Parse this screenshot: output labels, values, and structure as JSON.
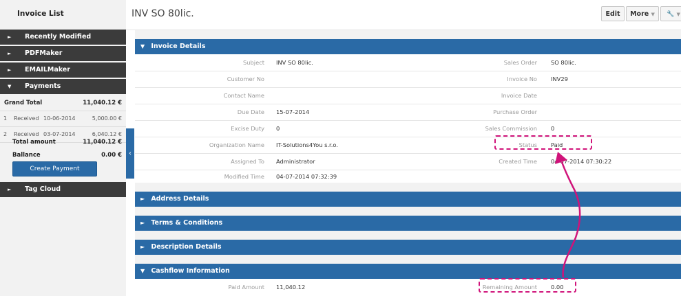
{
  "sidebar": {
    "title": "Invoice List",
    "sections": {
      "recently_modified": "Recently Modified",
      "pdfmaker": "PDFMaker",
      "emailmaker": "EMAILMaker",
      "payments": "Payments",
      "tag_cloud": "Tag Cloud"
    },
    "payments": {
      "grand_total_label": "Grand Total",
      "grand_total_value": "11,040.12 €",
      "rows": [
        {
          "num": "1",
          "status": "Received",
          "date": "10-06-2014",
          "amount": "5,000.00 €"
        },
        {
          "num": "2",
          "status": "Received",
          "date": "03-07-2014",
          "amount": "6,040.12 €"
        }
      ],
      "total_amount_label": "Total amount",
      "total_amount_value": "11,040.12 €",
      "balance_label": "Ballance",
      "balance_value": "0.00 €",
      "create_button": "Create Payment"
    }
  },
  "header": {
    "title": "INV SO 80lic.",
    "edit_label": "Edit",
    "more_label": "More"
  },
  "icons": {
    "expanded": "▼",
    "collapsed": "►",
    "collapse_sidebar": "‹",
    "caret": "▼",
    "wrench": "🔧"
  },
  "blocks": {
    "invoice_details": "Invoice Details",
    "address_details": "Address Details",
    "terms": "Terms & Conditions",
    "description": "Description Details",
    "cashflow": "Cashflow Information"
  },
  "details": [
    {
      "l1": "Subject",
      "v1": "INV SO 80lic.",
      "l2": "Sales Order",
      "v2": "SO 80lic."
    },
    {
      "l1": "Customer No",
      "v1": "",
      "l2": "Invoice No",
      "v2": "INV29"
    },
    {
      "l1": "Contact Name",
      "v1": "",
      "l2": "Invoice Date",
      "v2": ""
    },
    {
      "l1": "Due Date",
      "v1": "15-07-2014",
      "l2": "Purchase Order",
      "v2": ""
    },
    {
      "l1": "Excise Duty",
      "v1": "0",
      "l2": "Sales Commission",
      "v2": "0"
    },
    {
      "l1": "Organization Name",
      "v1": "IT-Solutions4You s.r.o.",
      "l2": "Status",
      "v2": "Paid"
    },
    {
      "l1": "Assigned To",
      "v1": "Administrator",
      "l2": "Created Time",
      "v2": "04-07-2014 07:30:22"
    },
    {
      "l1": "Modified Time",
      "v1": "04-07-2014 07:32:39",
      "l2": "",
      "v2": ""
    }
  ],
  "cashflow": {
    "paid_label": "Paid Amount",
    "paid_value": "11,040.12",
    "remaining_label": "Remaining Amount",
    "remaining_value": "0.00"
  },
  "colors": {
    "accent": "#2a6aa6",
    "sidebar_dark": "#3b3b3b",
    "highlight": "#d0137a"
  }
}
